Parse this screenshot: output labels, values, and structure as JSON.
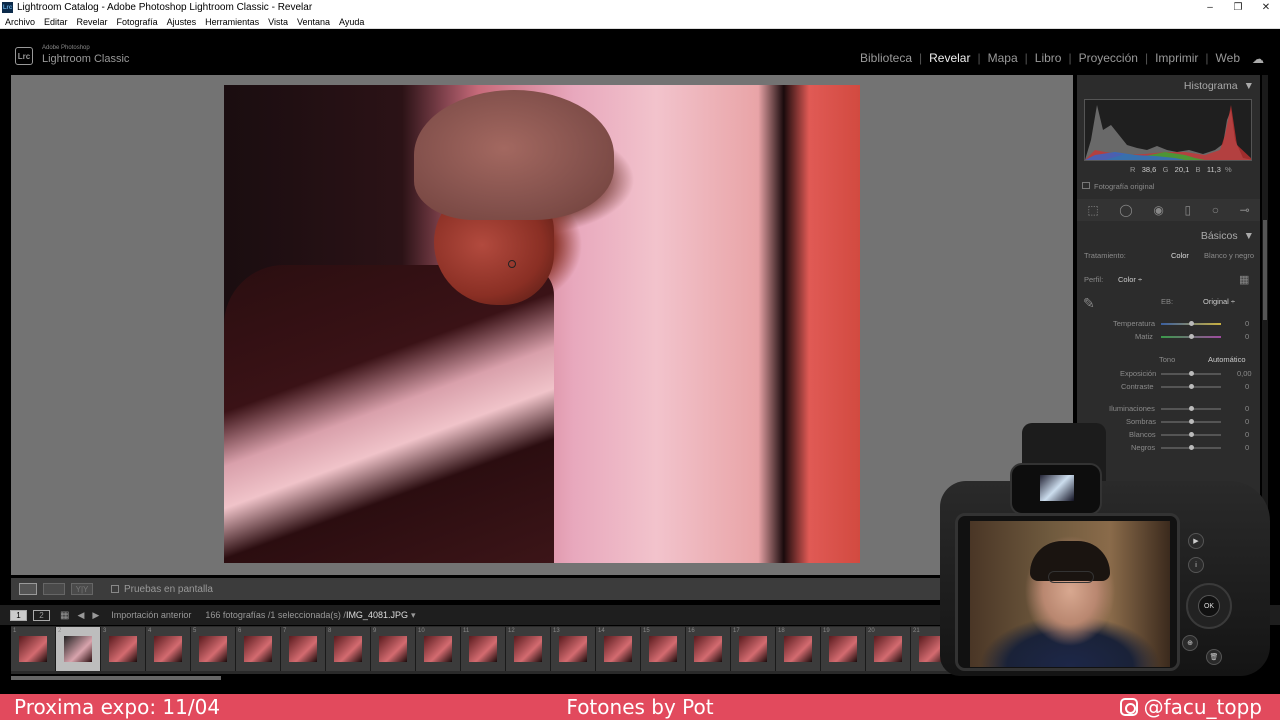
{
  "window": {
    "title": "Lightroom Catalog - Adobe Photoshop Lightroom Classic - Revelar",
    "app_icon": "Lrc",
    "controls": [
      "–",
      "❐",
      "✕"
    ]
  },
  "menu": [
    "Archivo",
    "Editar",
    "Revelar",
    "Fotografía",
    "Ajustes",
    "Herramientas",
    "Vista",
    "Ventana",
    "Ayuda"
  ],
  "brand": {
    "icon": "Lrc",
    "small": "Adobe Photoshop",
    "big": "Lightroom Classic"
  },
  "modules": {
    "items": [
      "Biblioteca",
      "Revelar",
      "Mapa",
      "Libro",
      "Proyección",
      "Imprimir",
      "Web"
    ],
    "active": "Revelar"
  },
  "toolbar": {
    "proof_label": "Pruebas en pantalla",
    "compare_label": "Y|Y"
  },
  "filmstrip_nav": {
    "view1": "1",
    "view2": "2",
    "source": "Importación anterior",
    "info": "166 fotografías /1 seleccionada(s) /",
    "filename": "IMG_4081.JPG",
    "dropdown_glyph": "▾"
  },
  "filmstrip": {
    "cells": [
      {
        "num": "1"
      },
      {
        "num": "2",
        "selected": true
      },
      {
        "num": "3"
      },
      {
        "num": "4"
      },
      {
        "num": "5"
      },
      {
        "num": "6"
      },
      {
        "num": "7"
      },
      {
        "num": "8"
      },
      {
        "num": "9"
      },
      {
        "num": "10"
      },
      {
        "num": "11"
      },
      {
        "num": "12"
      },
      {
        "num": "13"
      },
      {
        "num": "14"
      },
      {
        "num": "15"
      },
      {
        "num": "16"
      },
      {
        "num": "17"
      },
      {
        "num": "18"
      },
      {
        "num": "19"
      },
      {
        "num": "20"
      },
      {
        "num": "21"
      }
    ]
  },
  "histogram": {
    "title": "Histograma",
    "readout": {
      "r_label": "R",
      "r": "38,6",
      "g_label": "G",
      "g": "20,1",
      "b_label": "B",
      "b": "11,3",
      "unit": "%"
    },
    "original_label": "Fotografía original"
  },
  "basic": {
    "title": "Básicos",
    "treatment_label": "Tratamiento:",
    "treatment_color": "Color",
    "treatment_bw": "Blanco y negro",
    "profile_label": "Perfil:",
    "profile_value": "Color ÷",
    "wb_label": "EB:",
    "wb_value": "Original ÷",
    "temp_label": "Temperatura",
    "temp_value": "0",
    "tint_label": "Matiz",
    "tint_value": "0",
    "tone_label": "Tono",
    "auto_label": "Automático",
    "exposure_label": "Exposición",
    "exposure_value": "0,00",
    "contrast_label": "Contraste",
    "contrast_value": "0",
    "highlights_label": "Iluminaciones",
    "highlights_value": "0",
    "shadows_label": "Sombras",
    "shadows_value": "0",
    "whites_label": "Blancos",
    "whites_value": "0",
    "blacks_label": "Negros",
    "blacks_value": "0"
  },
  "banner": {
    "left": "Proxima expo: 11/04",
    "center": "Fotones by Pot",
    "right": "@facu_topp"
  },
  "camera_buttons": {
    "info": "i",
    "ok": "OK"
  },
  "colors": {
    "banner": "#e24a5d",
    "panel": "#2c2c2c",
    "center": "#737373"
  }
}
